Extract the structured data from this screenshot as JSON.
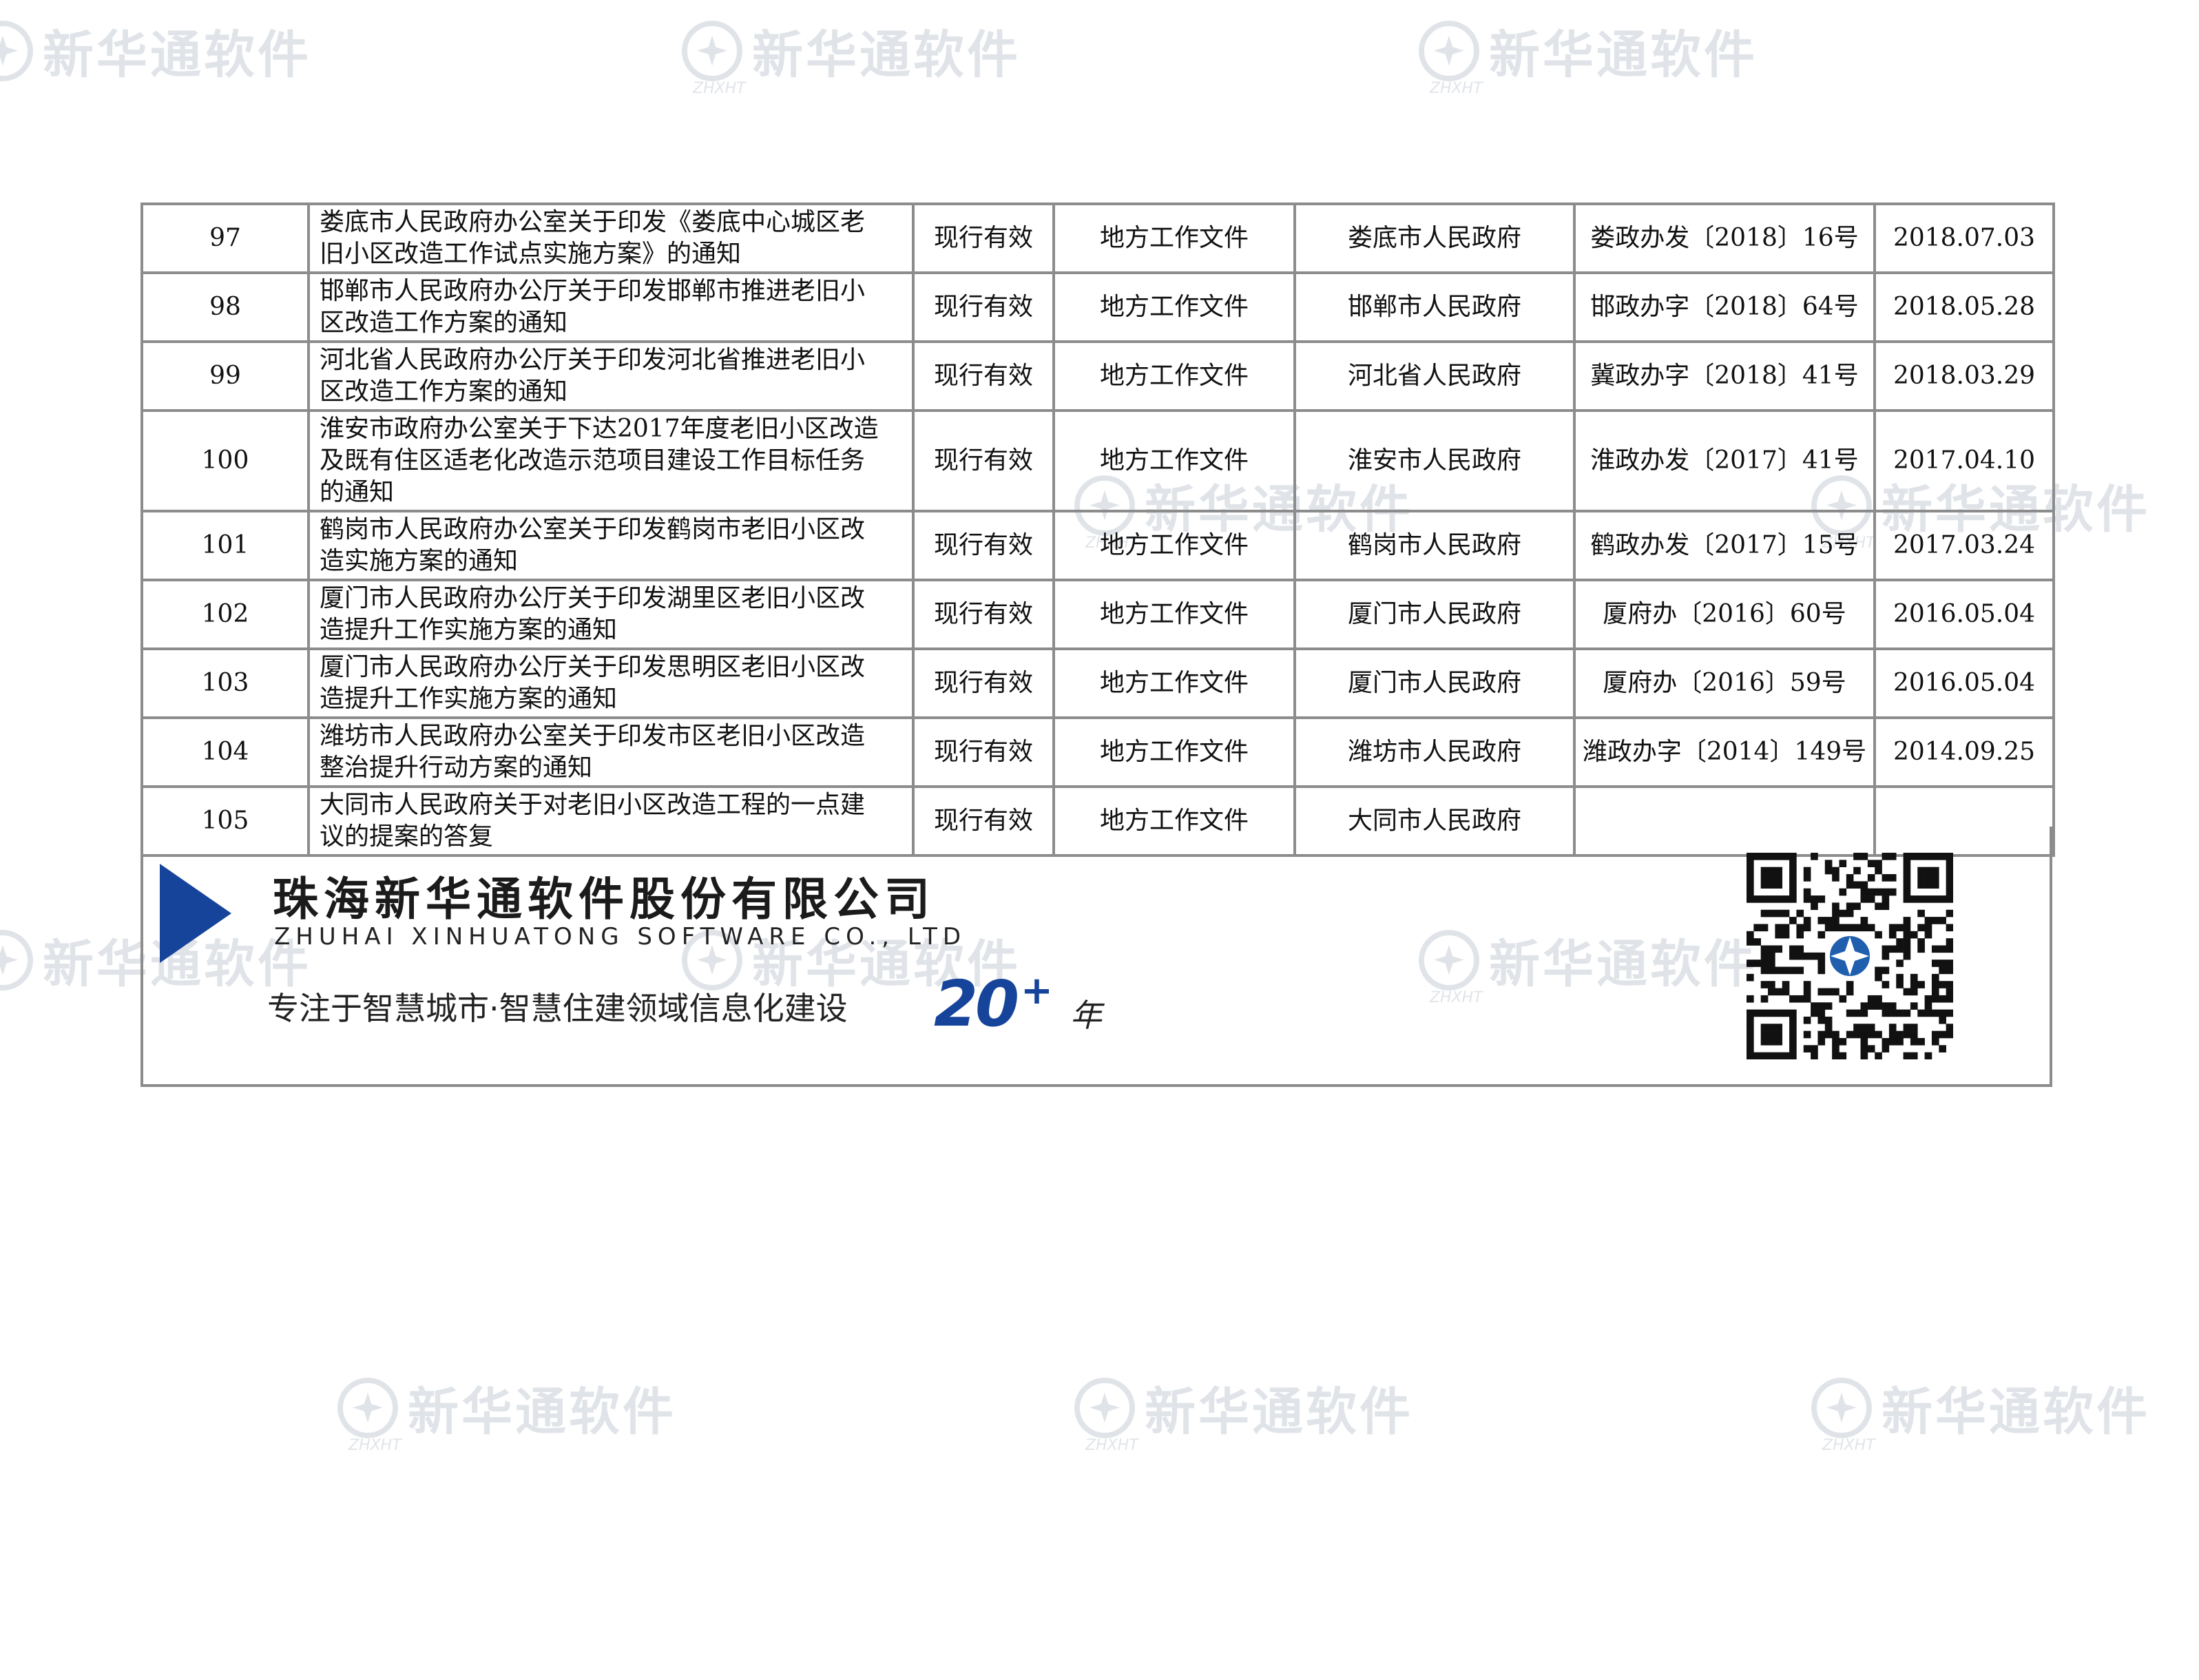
{
  "watermark": {
    "text": "新华通软件",
    "sub": "ZHXHT"
  },
  "table": {
    "rows": [
      {
        "no": "97",
        "title": [
          "娄底市人民政府办公室关于印发《娄底中心城区老",
          "旧小区改造工作试点实施方案》的通知"
        ],
        "status": "现行有效",
        "category": "地方工作文件",
        "issuer": "娄底市人民政府",
        "doc_no": "娄政办发〔2018〕16号",
        "date": "2018.07.03"
      },
      {
        "no": "98",
        "title": [
          "邯郸市人民政府办公厅关于印发邯郸市推进老旧小",
          "区改造工作方案的通知"
        ],
        "status": "现行有效",
        "category": "地方工作文件",
        "issuer": "邯郸市人民政府",
        "doc_no": "邯政办字〔2018〕64号",
        "date": "2018.05.28"
      },
      {
        "no": "99",
        "title": [
          "河北省人民政府办公厅关于印发河北省推进老旧小",
          "区改造工作方案的通知"
        ],
        "status": "现行有效",
        "category": "地方工作文件",
        "issuer": "河北省人民政府",
        "doc_no": "冀政办字〔2018〕41号",
        "date": "2018.03.29"
      },
      {
        "no": "100",
        "title": [
          "淮安市政府办公室关于下达2017年度老旧小区改造",
          "及既有住区适老化改造示范项目建设工作目标任务",
          "的通知"
        ],
        "status": "现行有效",
        "category": "地方工作文件",
        "issuer": "淮安市人民政府",
        "doc_no": "淮政办发〔2017〕41号",
        "date": "2017.04.10"
      },
      {
        "no": "101",
        "title": [
          "鹤岗市人民政府办公室关于印发鹤岗市老旧小区改",
          "造实施方案的通知"
        ],
        "status": "现行有效",
        "category": "地方工作文件",
        "issuer": "鹤岗市人民政府",
        "doc_no": "鹤政办发〔2017〕15号",
        "date": "2017.03.24"
      },
      {
        "no": "102",
        "title": [
          "厦门市人民政府办公厅关于印发湖里区老旧小区改",
          "造提升工作实施方案的通知"
        ],
        "status": "现行有效",
        "category": "地方工作文件",
        "issuer": "厦门市人民政府",
        "doc_no": "厦府办〔2016〕60号",
        "date": "2016.05.04"
      },
      {
        "no": "103",
        "title": [
          "厦门市人民政府办公厅关于印发思明区老旧小区改",
          "造提升工作实施方案的通知"
        ],
        "status": "现行有效",
        "category": "地方工作文件",
        "issuer": "厦门市人民政府",
        "doc_no": "厦府办〔2016〕59号",
        "date": "2016.05.04"
      },
      {
        "no": "104",
        "title": [
          "潍坊市人民政府办公室关于印发市区老旧小区改造",
          "整治提升行动方案的通知"
        ],
        "status": "现行有效",
        "category": "地方工作文件",
        "issuer": "潍坊市人民政府",
        "doc_no": "潍政办字〔2014〕149号",
        "date": "2014.09.25"
      },
      {
        "no": "105",
        "title": [
          "大同市人民政府关于对老旧小区改造工程的一点建",
          "议的提案的答复"
        ],
        "status": "现行有效",
        "category": "地方工作文件",
        "issuer": "大同市人民政府",
        "doc_no": "",
        "date": ""
      }
    ]
  },
  "footer": {
    "company": "珠海新华通软件股份有限公司",
    "company_en": "ZHUHAI XINHUATONG SOFTWARE CO., LTD",
    "slogan": "专注于智慧城市·智慧住建领域信息化建设",
    "years": "20",
    "years_suffix": "+",
    "years_unit": "年"
  }
}
